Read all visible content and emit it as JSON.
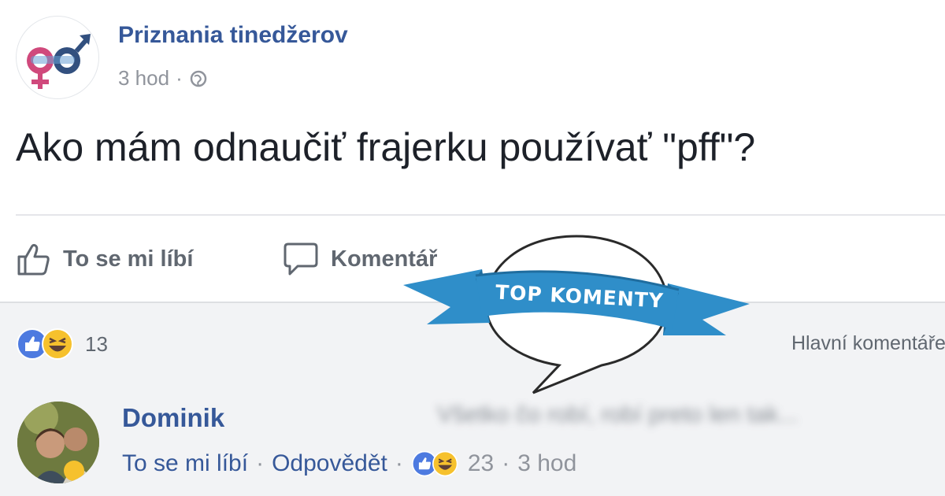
{
  "post": {
    "page_name": "Priznania tinedžerov",
    "time": "3 hod",
    "text": "Ako mám odnaučiť frajerku používať \"pff\"?"
  },
  "actions": {
    "like_label": "To se mi líbí",
    "comment_label": "Komentář"
  },
  "reactions": {
    "count": "13",
    "types": [
      "like",
      "haha"
    ]
  },
  "top_comments_link": "Hlavní komentáře",
  "badge": {
    "label": "TOP KOMENTY",
    "colors": {
      "ribbon": "#2f8ec9",
      "ribbon_dark": "#1f6d9f",
      "bubble_border": "#2a2a2a"
    }
  },
  "comment": {
    "author": "Dominik",
    "text": "Všetko čo robí, robí preto len tak...",
    "like_label": "To se mi líbí",
    "reply_label": "Odpovědět",
    "reaction_count": "23",
    "time": "3 hod"
  },
  "colors": {
    "link": "#365899",
    "muted": "#90949c",
    "like_blue": "#4d7ae0",
    "haha_yellow": "#f6c12d"
  }
}
